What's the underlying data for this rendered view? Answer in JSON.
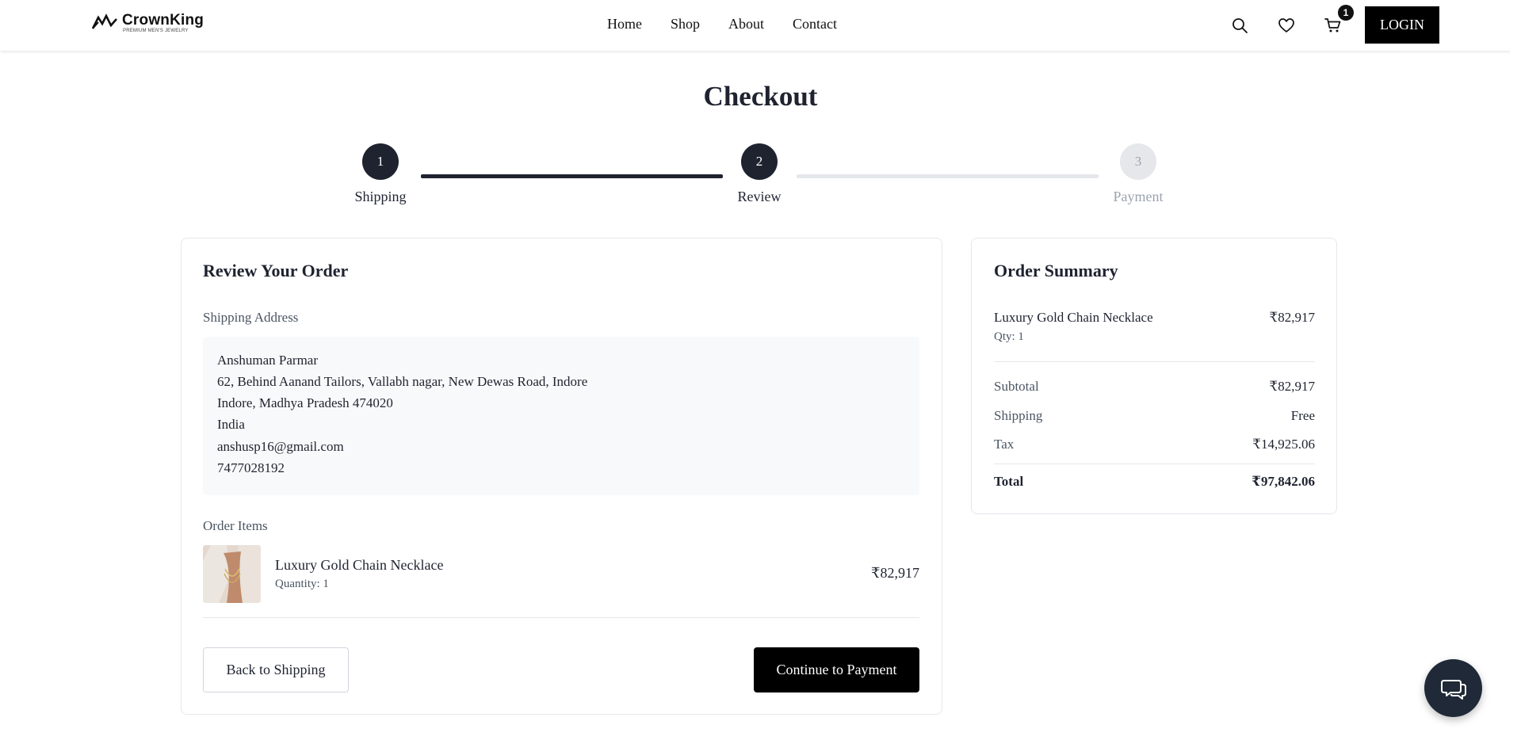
{
  "brand": {
    "name": "CrownKing",
    "tagline": "PREMIUM MEN'S JEWELRY"
  },
  "nav": {
    "items": [
      "Home",
      "Shop",
      "About",
      "Contact"
    ]
  },
  "header": {
    "cart_count": "1",
    "login_label": "LOGIN"
  },
  "page": {
    "title": "Checkout"
  },
  "steps": [
    {
      "number": "1",
      "label": "Shipping",
      "state": "complete"
    },
    {
      "number": "2",
      "label": "Review",
      "state": "active"
    },
    {
      "number": "3",
      "label": "Payment",
      "state": "pending"
    }
  ],
  "review": {
    "title": "Review Your Order",
    "shipping_label": "Shipping Address",
    "address": {
      "name": "Anshuman Parmar",
      "line1": "62, Behind Aanand Tailors, Vallabh nagar, New Dewas Road, Indore",
      "city_line": "Indore, Madhya Pradesh 474020",
      "country": "India",
      "email": "anshusp16@gmail.com",
      "phone": "7477028192"
    },
    "items_label": "Order Items",
    "item": {
      "name": "Luxury Gold Chain Necklace",
      "quantity": "Quantity: 1",
      "price": "₹82,917"
    },
    "back_label": "Back to Shipping",
    "continue_label": "Continue to Payment"
  },
  "summary": {
    "title": "Order Summary",
    "item": {
      "name": "Luxury Gold Chain Necklace",
      "qty": "Qty: 1",
      "price": "₹82,917"
    },
    "subtotal": {
      "label": "Subtotal",
      "value": "₹82,917"
    },
    "shipping": {
      "label": "Shipping",
      "value": "Free"
    },
    "tax": {
      "label": "Tax",
      "value": "₹14,925.06"
    },
    "total": {
      "label": "Total",
      "value": "₹97,842.06"
    }
  },
  "colors": {
    "primary": "#1f2330",
    "accent": "#000000",
    "muted": "#9ca3af"
  }
}
